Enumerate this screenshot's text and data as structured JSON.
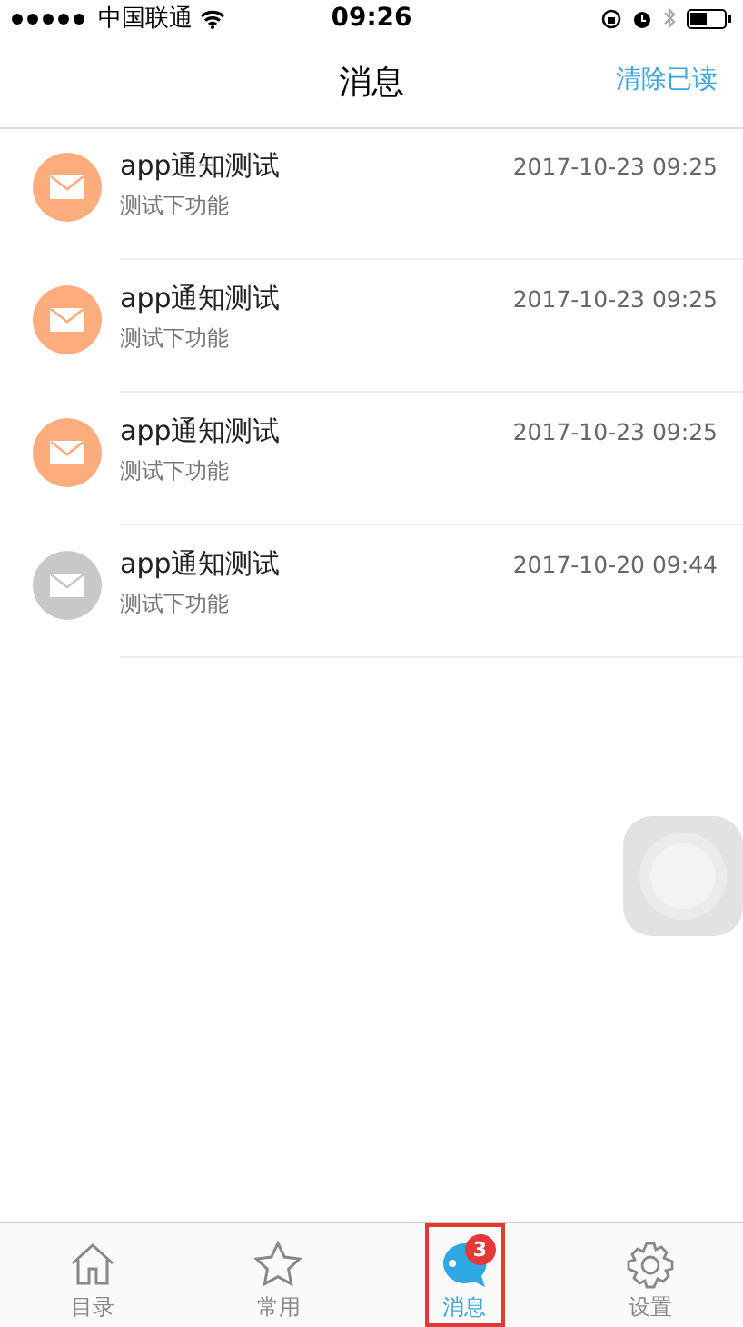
{
  "status_bar": {
    "carrier": "中国联通",
    "time": "09:26"
  },
  "nav": {
    "title": "消息",
    "action": "清除已读"
  },
  "messages": [
    {
      "title": "app通知测试",
      "body": "测试下功能",
      "time": "2017-10-23 09:25",
      "read": false
    },
    {
      "title": "app通知测试",
      "body": "测试下功能",
      "time": "2017-10-23 09:25",
      "read": false
    },
    {
      "title": "app通知测试",
      "body": "测试下功能",
      "time": "2017-10-23 09:25",
      "read": false
    },
    {
      "title": "app通知测试",
      "body": "测试下功能",
      "time": "2017-10-20 09:44",
      "read": true
    }
  ],
  "tabs": [
    {
      "label": "目录",
      "kind": "home",
      "selected": false
    },
    {
      "label": "常用",
      "kind": "star",
      "selected": false
    },
    {
      "label": "消息",
      "kind": "chat",
      "selected": true,
      "badge": "3"
    },
    {
      "label": "设置",
      "kind": "gear",
      "selected": false
    }
  ]
}
